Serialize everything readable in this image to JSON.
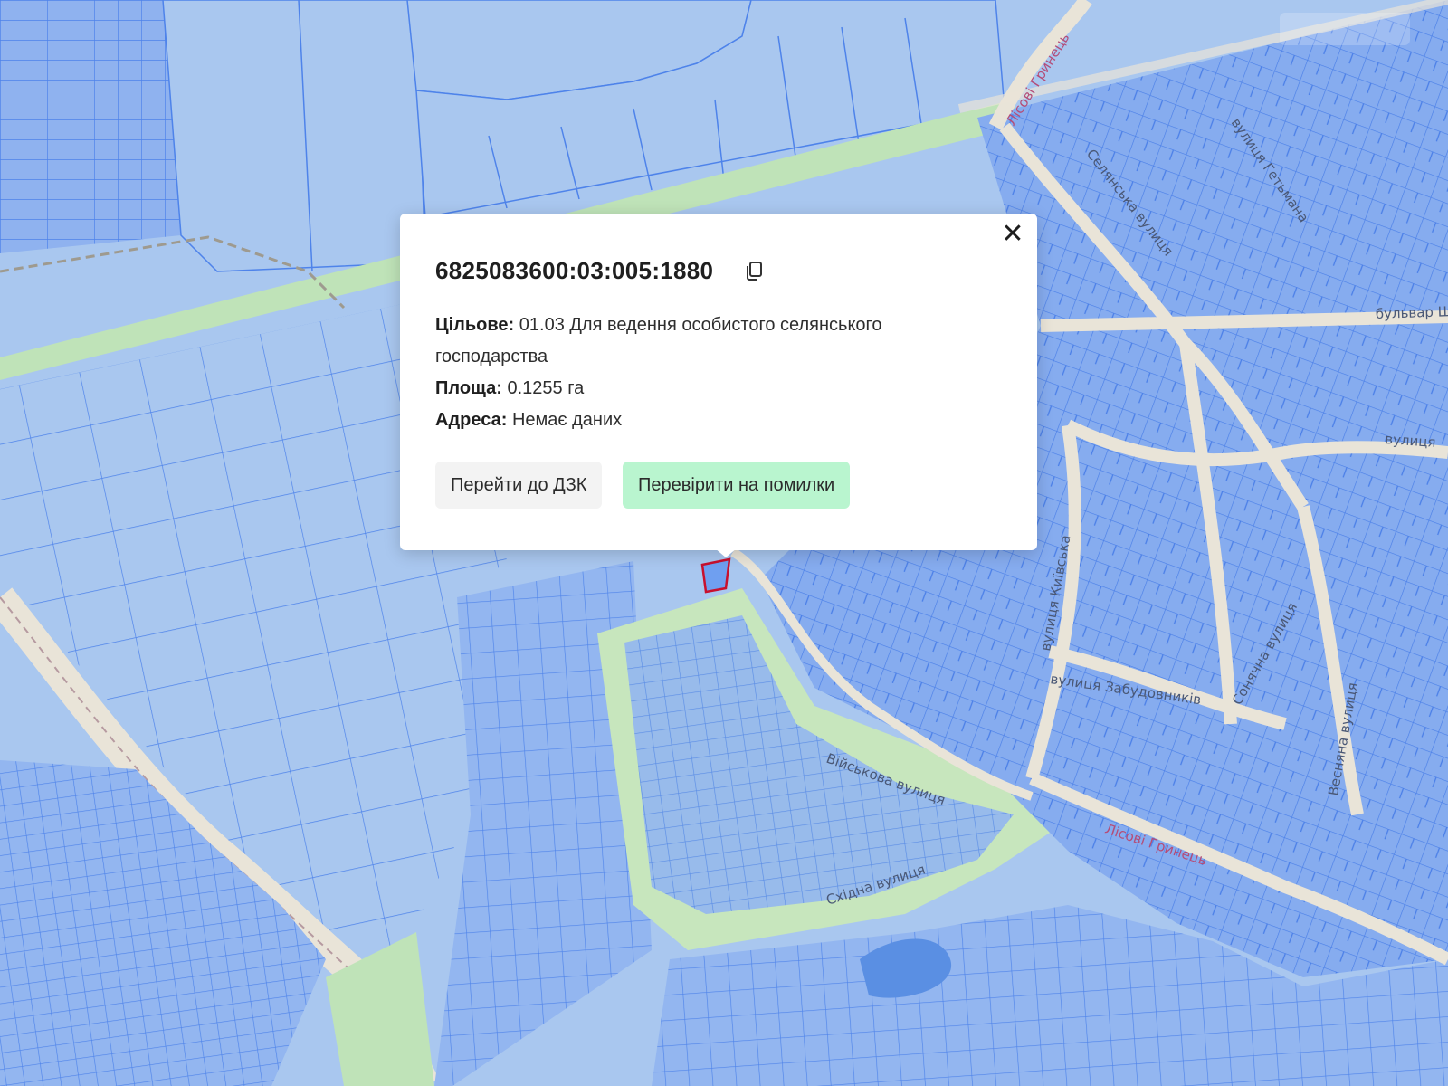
{
  "popup": {
    "cadastral_number": "6825083600:03:005:1880",
    "purpose_label": "Цільове:",
    "purpose_value": "01.03 Для ведення особистого селянського господарства",
    "area_label": "Площа:",
    "area_value": "0.1255 га",
    "address_label": "Адреса:",
    "address_value": "Немає даних",
    "close_symbol": "✕",
    "btn_go_dzk": "Перейти до ДЗК",
    "btn_check_errors": "Перевірити на помилки",
    "check_button_color": "#b9f5cf"
  },
  "map": {
    "parcel_color": "#6f9ff0",
    "background_color": "#a9c7ef",
    "highlight_color": "#c8102e",
    "streets": {
      "selected": "Селянська вулиця",
      "zabudovnykiv": "вулиця Забудовників",
      "vesniana": "Весняна вулиця",
      "skhidna": "Східна вулиця",
      "viiskova": "Військова вулиця",
      "boulevard": "бульвар Шев",
      "lisovi_top": "Лісові Гринець",
      "lisovi_bottom": "Лісові Гринець",
      "hetmanska": "вулиця Гетьмана",
      "kyivska": "вулиця Київська",
      "sonyachna": "Сонячна вулиця",
      "vulytsia_right": "вулиця"
    }
  }
}
